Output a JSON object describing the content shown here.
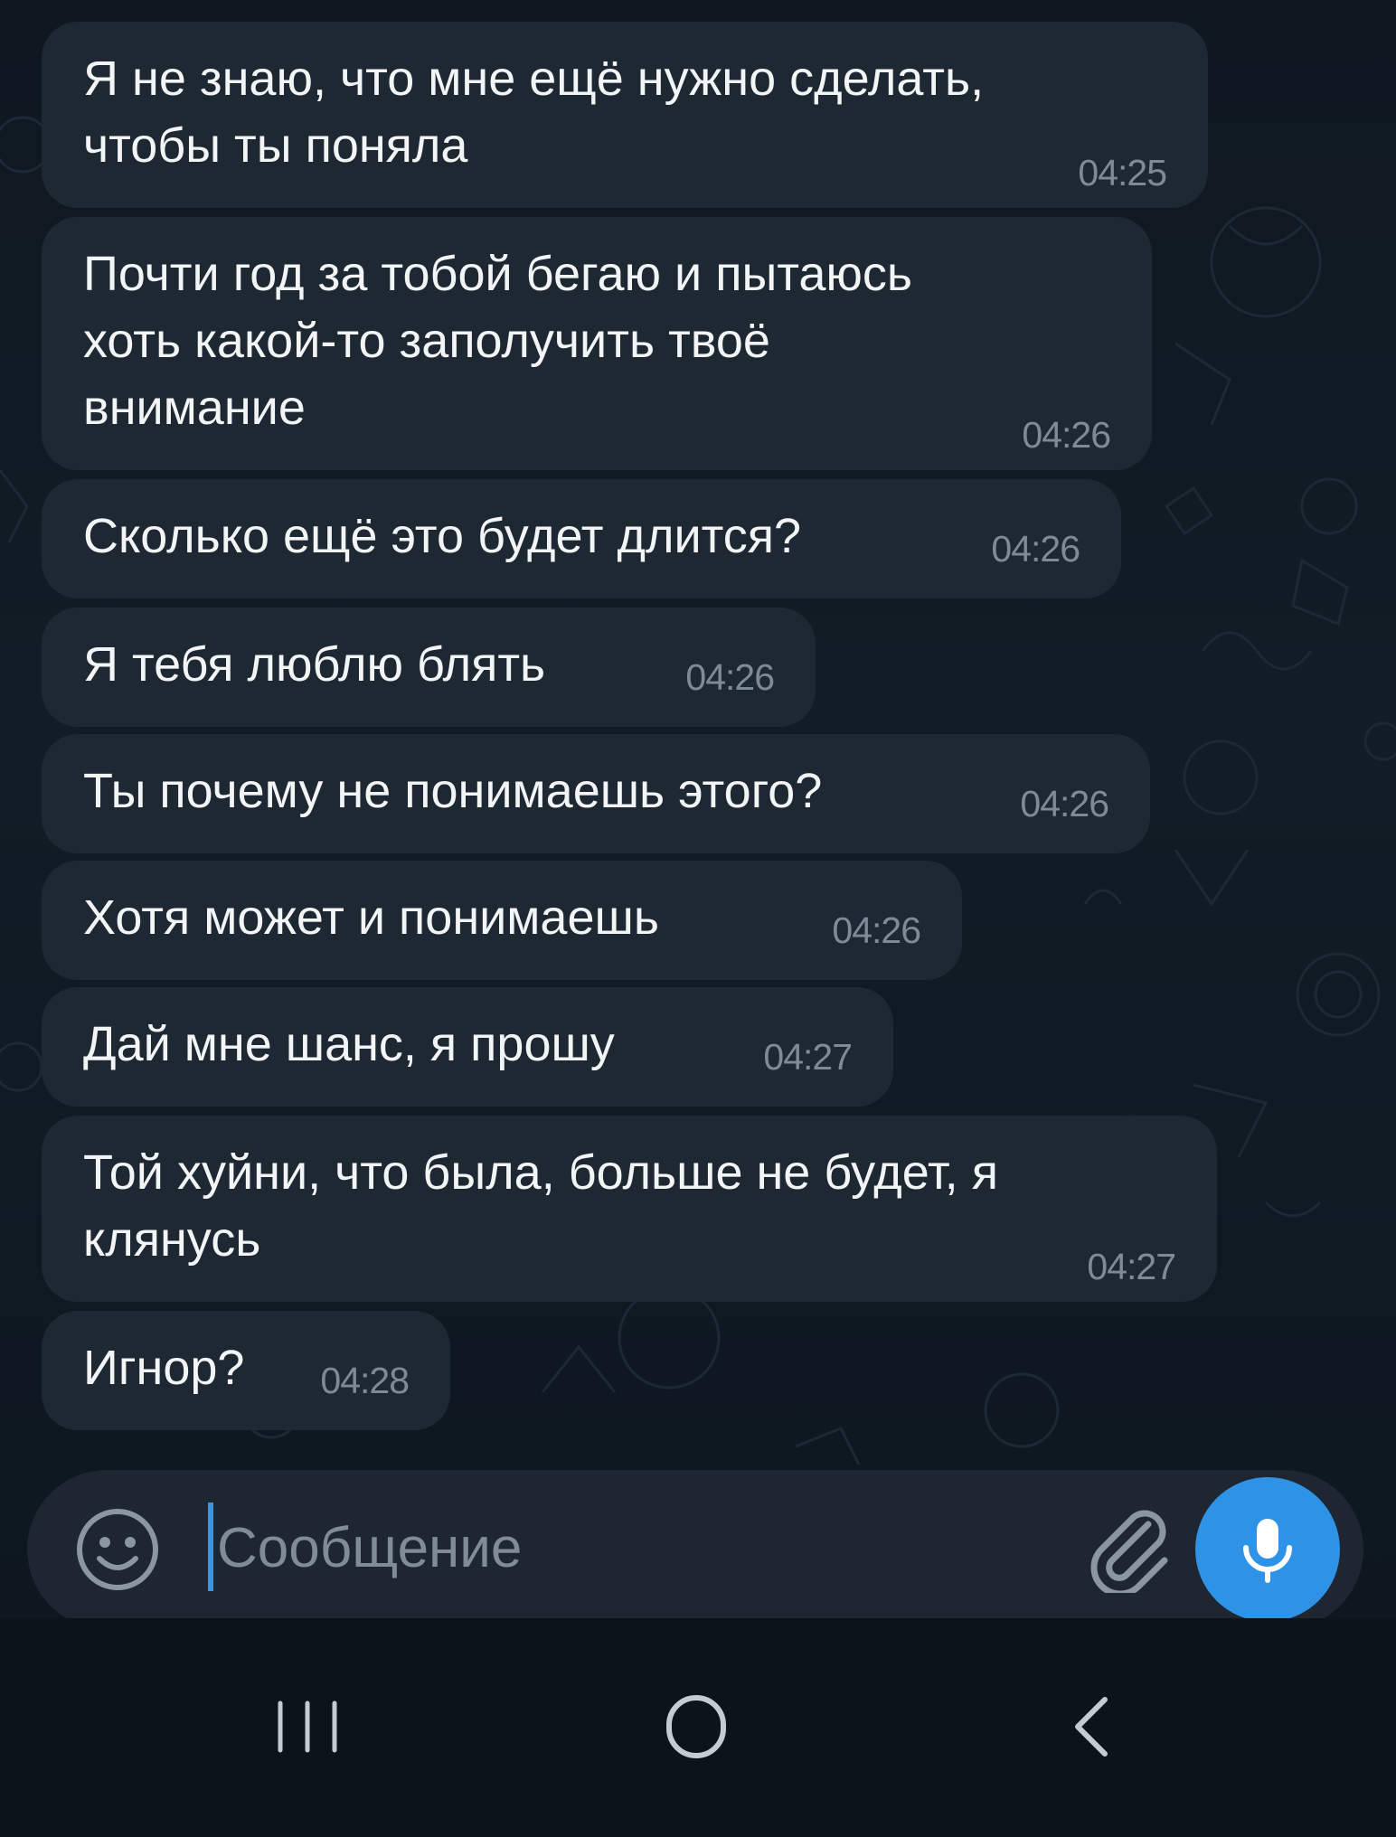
{
  "messages": [
    {
      "text": "Я не знаю, что мне ещё нужно сделать,\nчтобы ты поняла",
      "time": "04:25"
    },
    {
      "text": "Почти год за тобой бегаю и пытаюсь\nхоть какой-то заполучить твоё\nвнимание",
      "time": "04:26"
    },
    {
      "text": "Сколько ещё это будет длится?",
      "time": "04:26"
    },
    {
      "text": "Я тебя люблю блять",
      "time": "04:26"
    },
    {
      "text": "Ты почему не понимаешь этого?",
      "time": "04:26"
    },
    {
      "text": "Хотя может и понимаешь",
      "time": "04:26"
    },
    {
      "text": "Дай мне шанс, я прошу",
      "time": "04:27"
    },
    {
      "text": "Той хуйни, что была, больше не будет, я\nклянусь",
      "time": "04:27"
    },
    {
      "text": "Игнор?",
      "time": "04:28"
    }
  ],
  "input": {
    "placeholder": "Сообщение",
    "value": ""
  },
  "icons": {
    "emoji": "emoji-smile-icon",
    "attach": "paperclip-icon",
    "mic": "microphone-icon",
    "nav_recents": "recent-apps-icon",
    "nav_home": "home-icon",
    "nav_back": "back-chevron-icon"
  },
  "colors": {
    "background": "#0c131b",
    "bubble": "#1e2832",
    "text": "#f2f4f6",
    "time": "#7d8a97",
    "accent": "#2e93e6"
  }
}
